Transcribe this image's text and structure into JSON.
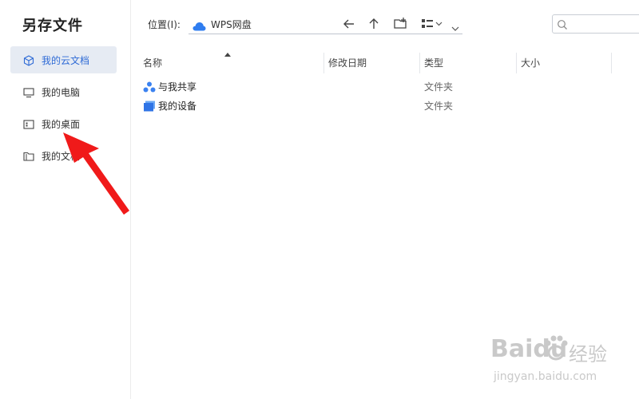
{
  "dialog": {
    "title": "另存文件"
  },
  "sidebar": {
    "items": [
      {
        "label": "我的云文档",
        "icon": "cube-icon",
        "active": true
      },
      {
        "label": "我的电脑",
        "icon": "monitor-icon",
        "active": false
      },
      {
        "label": "我的桌面",
        "icon": "desktop-icon",
        "active": false
      },
      {
        "label": "我的文档",
        "icon": "folder-icon",
        "active": false
      }
    ]
  },
  "toolbar": {
    "location_label": "位置(I):",
    "location_value": "WPS网盘",
    "search_placeholder": ""
  },
  "list": {
    "columns": [
      "名称",
      "修改日期",
      "类型",
      "大小"
    ],
    "rows": [
      {
        "name": "与我共享",
        "modified": "",
        "type": "文件夹",
        "size": "",
        "icon": "shared-icon"
      },
      {
        "name": "我的设备",
        "modified": "",
        "type": "文件夹",
        "size": "",
        "icon": "device-icon"
      }
    ]
  },
  "watermark": {
    "brand": "Baidu",
    "brand_cn": "经验",
    "url": "jingyan.baidu.com"
  },
  "colors": {
    "accent": "#2f6bd6",
    "active_bg": "#e6ebf3",
    "annotation": "#f01a1a"
  }
}
